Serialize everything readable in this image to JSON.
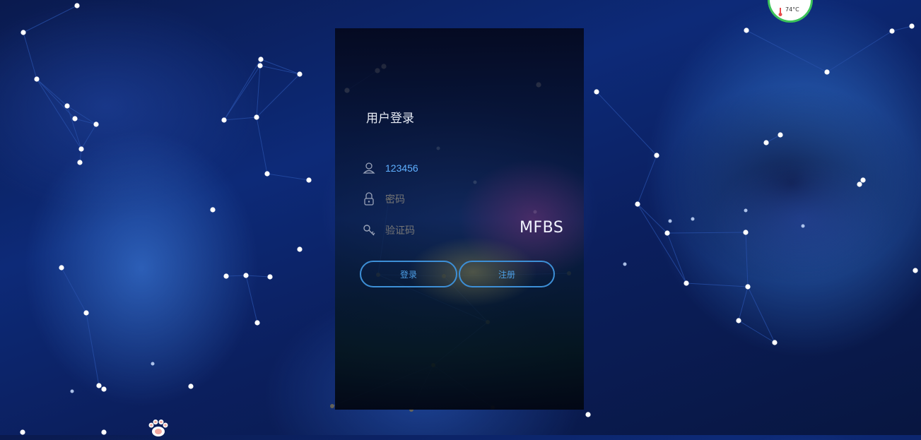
{
  "panel": {
    "title": "用户登录",
    "username_value": "123456",
    "password_placeholder": "密码",
    "captcha_placeholder": "验证码",
    "captcha_image_text": "MFBS",
    "login_label": "登录",
    "register_label": "注册"
  },
  "widget": {
    "temperature": "74°C"
  },
  "colors": {
    "accent": "#3d8fd6",
    "username_text": "#5fb0ff",
    "widget_ring": "#3cc35a"
  },
  "icons": {
    "username": "user-icon",
    "password": "lock-icon",
    "captcha": "key-icon",
    "temperature": "thermometer-icon",
    "pet": "cat-paw-icon"
  }
}
